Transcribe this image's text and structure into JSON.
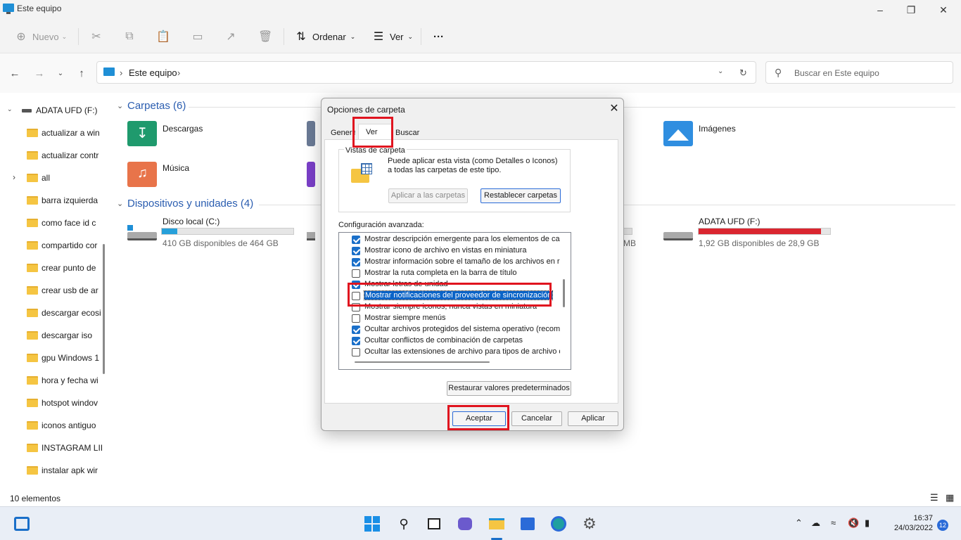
{
  "window": {
    "title": "Este equipo",
    "minimize_icon": "minimize-icon",
    "maximize_icon": "restore-icon",
    "close_icon": "close-icon"
  },
  "commandbar": {
    "new_label": "Nuevo",
    "sort_label": "Ordenar",
    "view_label": "Ver",
    "more_label": "···"
  },
  "address": {
    "crumb_root": "Este equipo",
    "search_placeholder": "Buscar en Este equipo"
  },
  "sidebar": {
    "drive_label": "ADATA UFD (F:)",
    "items": [
      "actualizar a win",
      "actualizar contr",
      "all",
      "barra izquierda",
      "como face id c",
      "compartido cor",
      "crear punto de",
      "crear usb de ar",
      "descargar ecosi",
      "descargar iso",
      "gpu Windows 1",
      "hora y fecha wi",
      "hotspot windov",
      "iconos antiguo",
      "INSTAGRAM LII",
      "instalar apk wir"
    ]
  },
  "content": {
    "folders_heading": "Carpetas (6)",
    "folders": [
      "Descargas",
      "Imágenes",
      "Música"
    ],
    "devices_heading": "Dispositivos y unidades (4)",
    "drives": [
      {
        "name": "Disco local (C:)",
        "free": "410 GB disponibles de 464 GB",
        "used_fraction": 0.12,
        "color": "#26a0da"
      },
      {
        "name": "ADATA UFD (F:)",
        "free": "1,92 GB disponibles de 28,9 GB",
        "used_fraction": 0.93,
        "color": "#da2630"
      }
    ],
    "partial_drive_text": "MB"
  },
  "status": {
    "item_count": "10 elementos"
  },
  "dialog": {
    "title": "Opciones de carpeta",
    "tabs": [
      "General",
      "Ver",
      "Buscar"
    ],
    "active_tab": "Ver",
    "group_title": "Vistas de carpeta",
    "group_desc": "Puede aplicar esta vista (como Detalles o Iconos) a todas las carpetas de este tipo.",
    "apply_to_folders": "Aplicar a las carpetas",
    "reset_folders": "Restablecer carpetas",
    "advanced_label": "Configuración avanzada:",
    "options": [
      {
        "label": "Mostrar descripción emergente para los elementos de carp",
        "checked": true
      },
      {
        "label": "Mostrar icono de archivo en vistas en miniatura",
        "checked": true
      },
      {
        "label": "Mostrar información sobre el tamaño de los archivos en rec",
        "checked": true
      },
      {
        "label": "Mostrar la ruta completa en la barra de título",
        "checked": false
      },
      {
        "label": "Mostrar letras de unidad",
        "checked": true
      },
      {
        "label": "Mostrar notificaciones del proveedor de sincronización",
        "checked": false,
        "selected": true
      },
      {
        "label": "Mostrar siempre iconos, nunca vistas en miniatura",
        "checked": false
      },
      {
        "label": "Mostrar siempre menús",
        "checked": false
      },
      {
        "label": "Ocultar archivos protegidos del sistema operativo (recomer",
        "checked": true
      },
      {
        "label": "Ocultar conflictos de combinación de carpetas",
        "checked": true
      },
      {
        "label": "Ocultar las extensiones de archivo para tipos de archivo co",
        "checked": false
      }
    ],
    "restore_defaults": "Restaurar valores predeterminados",
    "ok": "Aceptar",
    "cancel": "Cancelar",
    "apply": "Aplicar"
  },
  "taskbar": {
    "time": "16:37",
    "date": "24/03/2022",
    "notifications": "12"
  },
  "colors": {
    "accent": "#0a64c8",
    "highlight": "#e0141f"
  }
}
